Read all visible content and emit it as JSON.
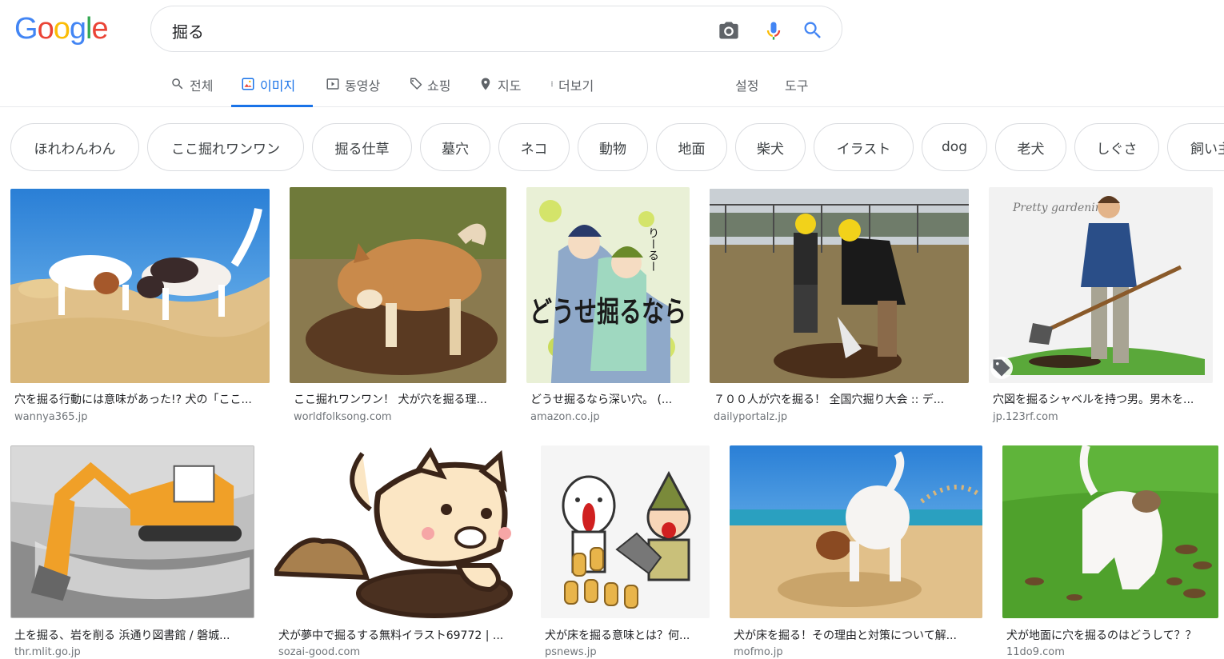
{
  "logo_text": [
    "G",
    "o",
    "o",
    "g",
    "l",
    "e"
  ],
  "logo_colors": [
    "#4285f4",
    "#ea4335",
    "#fbbc05",
    "#4285f4",
    "#34a853",
    "#ea4335"
  ],
  "search": {
    "query": "掘る"
  },
  "tabs": [
    "전체",
    "이미지",
    "동영상",
    "쇼핑",
    "지도",
    "더보기"
  ],
  "tools": {
    "settings": "설정",
    "tools": "도구"
  },
  "chips": [
    "ほれわんわん",
    "ここ掘れワンワン",
    "掘る仕草",
    "墓穴",
    "ネコ",
    "動物",
    "地面",
    "柴犬",
    "イラスト",
    "dog",
    "老犬",
    "しぐさ",
    "飼い主"
  ],
  "results": [
    {
      "title": "穴を掘る行動には意味があった!? 犬の「ここ...",
      "source": "wannya365.jp"
    },
    {
      "title": "ここ掘れワンワン！ 犬が穴を掘る理...",
      "source": "worldfolksong.com"
    },
    {
      "title": "どうせ掘るなら深い穴。 (...",
      "source": "amazon.co.jp"
    },
    {
      "title": "７００人が穴を掘る！ 全国穴掘り大会 :: デ...",
      "source": "dailyportalz.jp"
    },
    {
      "title": "穴図を掘るシャベルを持つ男。男木を...",
      "source": "jp.123rf.com"
    },
    {
      "title": "土を掘る、岩を削る 浜通り図書館 / 磐城...",
      "source": "thr.mlit.go.jp"
    },
    {
      "title": "犬が夢中で掘るする無料イラスト69772 | ...",
      "source": "sozai-good.com"
    },
    {
      "title": "犬が床を掘る意味とは？何...",
      "source": "psnews.jp"
    },
    {
      "title": "犬が床を掘る！その理由と対策について解...",
      "source": "mofmo.jp"
    },
    {
      "title": "犬が地面に穴を掘るのはどうして？？",
      "source": "11do9.com"
    }
  ],
  "image_text": {
    "manga_title": "どうせ掘るなら",
    "manga_author": "りーるー",
    "pretty_gardening": "Pretty gardening"
  },
  "accent_color": "#1a73e8"
}
